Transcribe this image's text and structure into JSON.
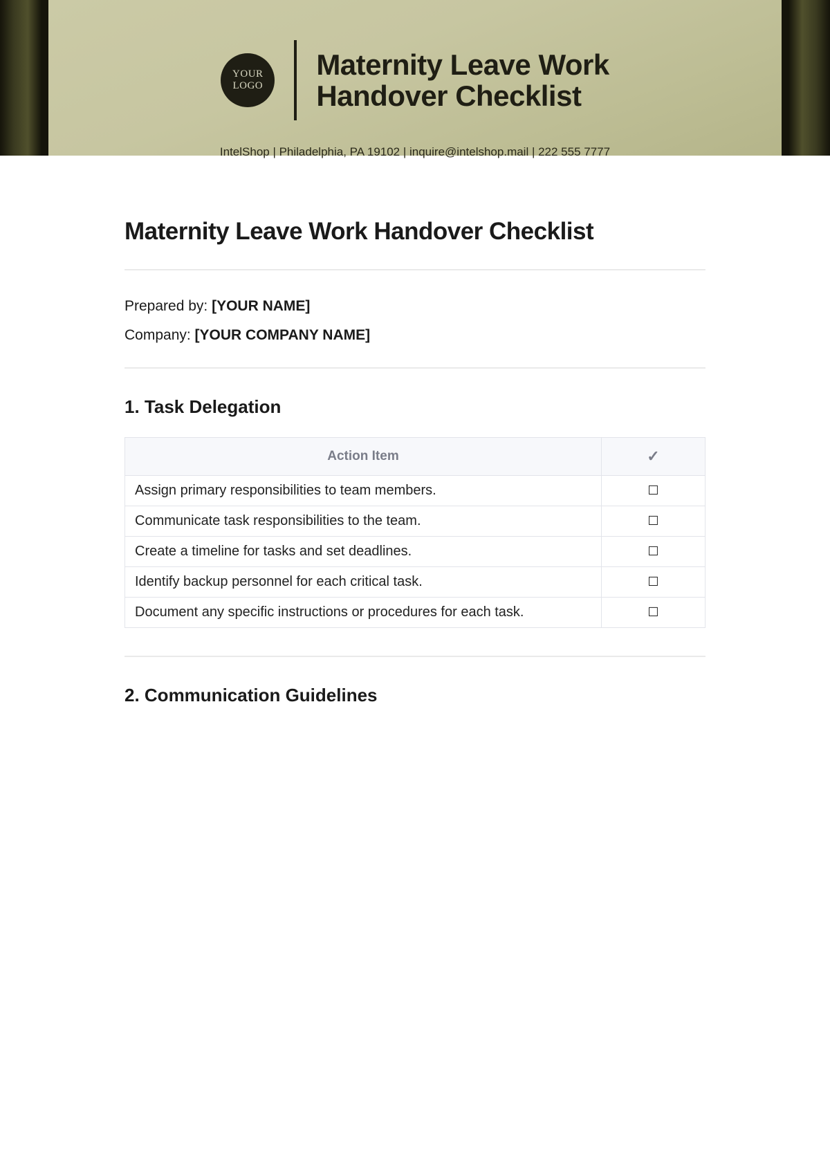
{
  "header": {
    "logo_line1": "YOUR",
    "logo_line2": "LOGO",
    "title_line1": "Maternity Leave Work",
    "title_line2": "Handover Checklist",
    "contact": "IntelShop | Philadelphia, PA 19102 | inquire@intelshop.mail | 222 555 7777"
  },
  "main_title": "Maternity Leave Work Handover Checklist",
  "meta": {
    "prepared_by_label": "Prepared by: ",
    "prepared_by_value": "[YOUR NAME]",
    "company_label": "Company: ",
    "company_value": "[YOUR COMPANY NAME]"
  },
  "section1": {
    "title": "1. Task Delegation",
    "col_action": "Action Item",
    "col_check": "✓",
    "items": [
      "Assign primary responsibilities to team members.",
      "Communicate task responsibilities to the team.",
      "Create a timeline for tasks and set deadlines.",
      "Identify backup personnel for each critical task.",
      "Document any specific instructions or procedures for each task."
    ]
  },
  "section2": {
    "title": "2. Communication Guidelines"
  },
  "checkbox_glyph": "☐"
}
